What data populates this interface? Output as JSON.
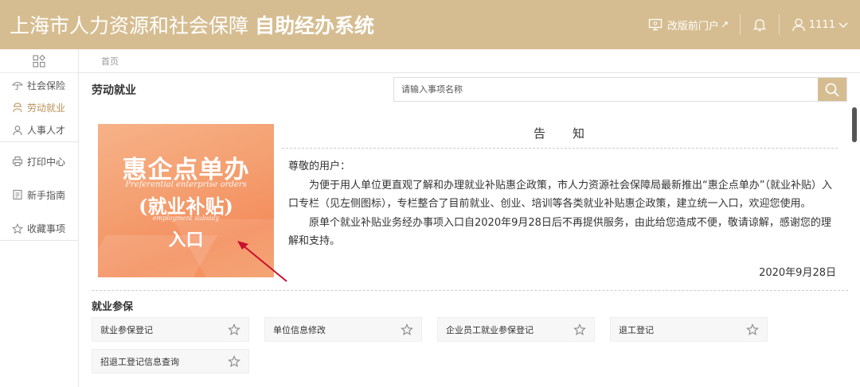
{
  "header": {
    "title": "上海市人力资源和社会保障",
    "title_bold": "自助经办系统",
    "old_portal_label": "改版前门户",
    "username": "1111"
  },
  "sidebar": {
    "items": [
      {
        "label": "社会保险",
        "icon": "umbrella-icon",
        "active": false
      },
      {
        "label": "劳动就业",
        "icon": "worker-icon",
        "active": true
      },
      {
        "label": "人事人才",
        "icon": "person-icon",
        "active": false
      },
      {
        "label": "打印中心",
        "icon": "printer-icon",
        "active": false
      },
      {
        "label": "新手指南",
        "icon": "guide-icon",
        "active": false
      },
      {
        "label": "收藏事项",
        "icon": "star-icon",
        "active": false
      }
    ]
  },
  "breadcrumb": {
    "home": "首页"
  },
  "main": {
    "section_title": "劳动就业",
    "search": {
      "placeholder": "请输入事项名称"
    }
  },
  "banner": {
    "line1": "惠企点单办",
    "line2": "Preferential enterprise orders",
    "line3": "(就业补贴)",
    "line4": "employment subsidy",
    "line5": "入口"
  },
  "notice": {
    "title_char1": "告",
    "title_char2": "知",
    "greeting": "尊敬的用户：",
    "para1": "为便于用人单位更直观了解和办理就业补贴惠企政策，市人力资源社会保障局最新推出“惠企点单办”（就业补贴）入口专栏（见左侧图标），专栏整合了目前就业、创业、培训等各类就业补贴惠企政策，建立统一入口，欢迎您使用。",
    "para2": "原单个就业补贴业务经办事项入口自2020年9月28日后不再提供服务，由此给您造成不便，敬请谅解，感谢您的理解和支持。",
    "date": "2020年9月28日"
  },
  "category": {
    "title": "就业参保",
    "items": [
      {
        "label": "就业参保登记"
      },
      {
        "label": "单位信息修改"
      },
      {
        "label": "企业员工就业参保登记"
      },
      {
        "label": "退工登记"
      },
      {
        "label": "招退工登记信息查询"
      }
    ]
  },
  "colors": {
    "brand": "#d6bd91",
    "active": "#b8925a"
  }
}
